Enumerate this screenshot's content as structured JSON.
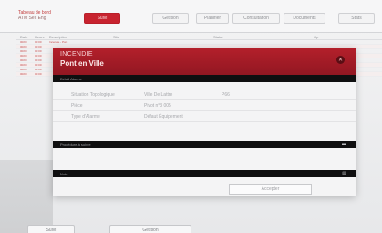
{
  "app": {
    "brand_line1": "Tableau de bord",
    "brand_line2": "ATM Sec Eng"
  },
  "tabs": [
    {
      "label": "Suivi"
    },
    {
      "label": "Gestion"
    },
    {
      "label": "Planifier"
    },
    {
      "label": "Consultation"
    },
    {
      "label": "Documents"
    },
    {
      "label": "Stats"
    }
  ],
  "table": {
    "headers": [
      "Date",
      "Heure",
      "Description",
      "Site",
      "Statut",
      "Op"
    ],
    "rows": [
      [
        "00/00",
        "00:00",
        "Incendie - Pont",
        "Ville",
        "En cours",
        "01"
      ],
      [
        "00/00",
        "00:00",
        "Incendie - Pont",
        "Ville",
        "En cours",
        "01"
      ],
      [
        "00/00",
        "00:00",
        "Incendie - Pont",
        "Ville",
        "En cours",
        "01"
      ],
      [
        "00/00",
        "00:00",
        "Incendie - Pont",
        "Ville",
        "En cours",
        "01"
      ],
      [
        "00/00",
        "00:00",
        "Incendie - Pont",
        "Ville",
        "En cours",
        "01"
      ],
      [
        "00/00",
        "00:00",
        "Incendie - Pont",
        "Ville",
        "En cours",
        "01"
      ],
      [
        "00/00",
        "00:00",
        "Incendie - Pont",
        "Ville",
        "En cours",
        "01"
      ],
      [
        "00/00",
        "00:00",
        "Incendie - Pont",
        "Ville",
        "En cours",
        "01"
      ]
    ]
  },
  "modal": {
    "kicker": "INCENDIE",
    "title": "Pont en Ville",
    "close_icon": "close-icon",
    "section_detail": "Détail Alarme",
    "details": [
      {
        "key": "Situation Topologique",
        "value": "Ville De Lattre",
        "value2": "P66"
      },
      {
        "key": "Pièce",
        "value": "Pivot n°3 005"
      },
      {
        "key": "Type d'Alarme",
        "value": "Défaut Équipement"
      }
    ],
    "section_procedure": "Procédure à suivre",
    "section_note": "Note",
    "accept_label": "Accepter"
  },
  "bottom": {
    "btn1": "Suivi",
    "btn2": "Gestion"
  },
  "colors": {
    "accent_red": "#b4202b",
    "bar_black": "#0f0f10"
  }
}
